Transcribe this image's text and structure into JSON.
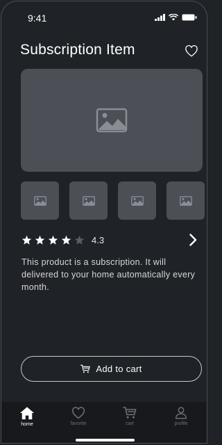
{
  "status_bar": {
    "time": "9:41"
  },
  "header": {
    "title": "Subscription Item"
  },
  "rating": {
    "stars": 4,
    "max": 5,
    "value": "4.3"
  },
  "product": {
    "description": "This product is a subscription. It will delivered to your home automatically every month.",
    "thumbnail_count": 4
  },
  "actions": {
    "add_to_cart": "Add to cart"
  },
  "tabbar": {
    "tabs": [
      {
        "label": "home",
        "icon": "home-icon",
        "active": true
      },
      {
        "label": "favorite",
        "icon": "heart-icon",
        "active": false
      },
      {
        "label": "cart",
        "icon": "cart-icon",
        "active": false
      },
      {
        "label": "profile",
        "icon": "person-icon",
        "active": false
      }
    ]
  },
  "colors": {
    "background": "#1f2227",
    "placeholder": "#4c4f55",
    "tabbar": "#17191d",
    "star_filled": "#ffffff",
    "star_empty": "#5a5d63"
  }
}
